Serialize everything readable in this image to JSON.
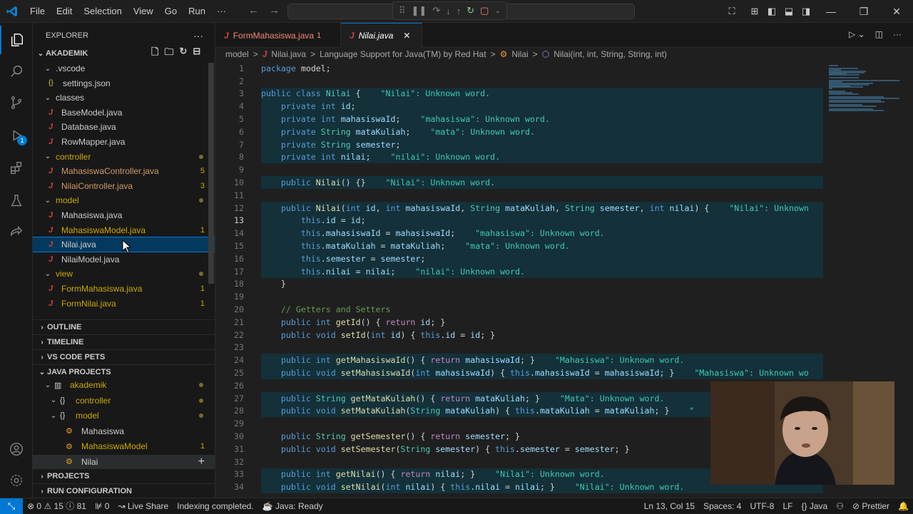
{
  "titlebar": {
    "menu": [
      "File",
      "Edit",
      "Selection",
      "View",
      "Go",
      "Run",
      "···"
    ],
    "back": "←",
    "forward": "→"
  },
  "sidebar": {
    "title": "EXPLORER",
    "more": "···",
    "root": "AKADEMIK",
    "tree": [
      {
        "label": ".vscode",
        "type": "folder",
        "indent": 1
      },
      {
        "label": "settings.json",
        "type": "json",
        "indent": 2
      },
      {
        "label": "classes",
        "type": "folder",
        "indent": 1
      },
      {
        "label": "BaseModel.java",
        "type": "java",
        "indent": 2
      },
      {
        "label": "Database.java",
        "type": "java",
        "indent": 2
      },
      {
        "label": "RowMapper.java",
        "type": "java",
        "indent": 2
      },
      {
        "label": "controller",
        "type": "folder",
        "indent": 1,
        "status": "modified"
      },
      {
        "label": "MahasiswaController.java",
        "type": "java",
        "indent": 2,
        "count": "5",
        "status": "modified"
      },
      {
        "label": "NilaiController.java",
        "type": "java",
        "indent": 2,
        "count": "3",
        "status": "modified"
      },
      {
        "label": "model",
        "type": "folder",
        "indent": 1,
        "status": "modified"
      },
      {
        "label": "Mahasiswa.java",
        "type": "java",
        "indent": 2
      },
      {
        "label": "MahasiswaModel.java",
        "type": "java",
        "indent": 2,
        "count": "1",
        "status": "modified"
      },
      {
        "label": "Nilai.java",
        "type": "java",
        "indent": 2,
        "selected": true
      },
      {
        "label": "NilaiModel.java",
        "type": "java",
        "indent": 2
      },
      {
        "label": "view",
        "type": "folder",
        "indent": 1,
        "status": "modified"
      },
      {
        "label": "FormMahasiswa.java",
        "type": "java",
        "indent": 2,
        "count": "1",
        "status": "modified"
      },
      {
        "label": "FormNilai.java",
        "type": "java",
        "indent": 2,
        "count": "1",
        "status": "modified"
      }
    ],
    "sections": {
      "outline": "OUTLINE",
      "timeline": "TIMELINE",
      "pets": "VS CODE PETS",
      "java_projects": "JAVA PROJECTS",
      "projects": "PROJECTS",
      "run_config": "RUN CONFIGURATION"
    },
    "java_tree": [
      {
        "label": "akademik",
        "indent": 1
      },
      {
        "label": "controller",
        "indent": 2
      },
      {
        "label": "model",
        "indent": 2
      },
      {
        "label": "Mahasiswa",
        "indent": 3
      },
      {
        "label": "MahasiswaModel",
        "indent": 3,
        "count": "1"
      },
      {
        "label": "Nilai",
        "indent": 3
      }
    ],
    "debug_badge": "1"
  },
  "tabs": [
    {
      "label": "FormMahasiswa.java",
      "count": "1",
      "active": false
    },
    {
      "label": "Nilai.java",
      "active": true,
      "close": "✕"
    }
  ],
  "breadcrumb": [
    "model",
    ">",
    "Nilai.java",
    ">",
    "Language Support for Java(TM) by Red Hat",
    ">",
    "Nilai",
    ">",
    "Nilai(int, int, String, String, int)"
  ],
  "editor": {
    "current_line": 13,
    "lines": [
      {
        "n": "1",
        "html": "<span class='kw'>package</span> model;"
      },
      {
        "n": "2",
        "html": ""
      },
      {
        "n": "3",
        "html": "<span class='kw'>public class</span> <span class='ty'>Nilai</span> {    <span class='spell'>\"Nilai\": Unknown word.</span>",
        "hl": true
      },
      {
        "n": "4",
        "html": "    <span class='kw'>private int</span> <span class='vr'>id</span>;",
        "hl": true
      },
      {
        "n": "5",
        "html": "    <span class='kw'>private int</span> <span class='vr'>mahasiswaId</span>;    <span class='spell'>\"mahasiswa\": Unknown word.</span>",
        "hl": true
      },
      {
        "n": "6",
        "html": "    <span class='kw'>private</span> <span class='ty'>String</span> <span class='vr'>mataKuliah</span>;    <span class='spell'>\"mata\": Unknown word.</span>",
        "hl": true
      },
      {
        "n": "7",
        "html": "    <span class='kw'>private</span> <span class='ty'>String</span> <span class='vr'>semester</span>;",
        "hl": true
      },
      {
        "n": "8",
        "html": "    <span class='kw'>private int</span> <span class='vr'>nilai</span>;    <span class='spell'>\"nilai\": Unknown word.</span>",
        "hl": true
      },
      {
        "n": "9",
        "html": ""
      },
      {
        "n": "10",
        "html": "    <span class='kw'>public</span> <span class='fn'>Nilai</span>() {}    <span class='spell'>\"Nilai\": Unknown word.</span>",
        "hl": true
      },
      {
        "n": "11",
        "html": ""
      },
      {
        "n": "12",
        "html": "    <span class='kw'>public</span> <span class='fn'>Nilai</span>(<span class='kw'>int</span> <span class='vr'>id</span>, <span class='kw'>int</span> <span class='vr'>mahasiswaId</span>, <span class='ty'>String</span> <span class='vr'>mataKuliah</span>, <span class='ty'>String</span> <span class='vr'>semester</span>, <span class='kw'>int</span> <span class='vr'>nilai</span>) {    <span class='spell'>\"Nilai\": Unknown</span>",
        "hl": true
      },
      {
        "n": "13",
        "html": "        <span class='kw'>this</span>.<span class='vr'>id</span> = <span class='vr'>id</span>;",
        "hl": true
      },
      {
        "n": "14",
        "html": "        <span class='kw'>this</span>.<span class='vr'>mahasiswaId</span> = <span class='vr'>mahasiswaId</span>;    <span class='spell'>\"mahasiswa\": Unknown word.</span>",
        "hl": true
      },
      {
        "n": "15",
        "html": "        <span class='kw'>this</span>.<span class='vr'>mataKuliah</span> = <span class='vr'>mataKuliah</span>;    <span class='spell'>\"mata\": Unknown word.</span>",
        "hl": true
      },
      {
        "n": "16",
        "html": "        <span class='kw'>this</span>.<span class='vr'>semester</span> = <span class='vr'>semester</span>;",
        "hl": true
      },
      {
        "n": "17",
        "html": "        <span class='kw'>this</span>.<span class='vr'>nilai</span> = <span class='vr'>nilai</span>;    <span class='spell'>\"nilai\": Unknown word.</span>",
        "hl": true
      },
      {
        "n": "18",
        "html": "    }"
      },
      {
        "n": "19",
        "html": ""
      },
      {
        "n": "20",
        "html": "    <span class='cm'>// Getters and Setters</span>"
      },
      {
        "n": "21",
        "html": "    <span class='kw'>public int</span> <span class='fn'>getId</span>() { <span class='ctl'>return</span> <span class='vr'>id</span>; }"
      },
      {
        "n": "22",
        "html": "    <span class='kw'>public void</span> <span class='fn'>setId</span>(<span class='kw'>int</span> <span class='vr'>id</span>) { <span class='kw'>this</span>.<span class='vr'>id</span> = <span class='vr'>id</span>; }"
      },
      {
        "n": "23",
        "html": ""
      },
      {
        "n": "24",
        "html": "    <span class='kw'>public int</span> <span class='fn'>getMahasiswaId</span>() { <span class='ctl'>return</span> <span class='vr'>mahasiswaId</span>; }    <span class='spell'>\"Mahasiswa\": Unknown word.</span>",
        "hl": true
      },
      {
        "n": "25",
        "html": "    <span class='kw'>public void</span> <span class='fn'>setMahasiswaId</span>(<span class='kw'>int</span> <span class='vr'>mahasiswaId</span>) { <span class='kw'>this</span>.<span class='vr'>mahasiswaId</span> = <span class='vr'>mahasiswaId</span>; }    <span class='spell'>\"Mahasiswa\": Unknown wo</span>",
        "hl": true
      },
      {
        "n": "26",
        "html": ""
      },
      {
        "n": "27",
        "html": "    <span class='kw'>public</span> <span class='ty'>String</span> <span class='fn'>getMataKuliah</span>() { <span class='ctl'>return</span> <span class='vr'>mataKuliah</span>; }    <span class='spell'>\"Mata\": Unknown word.</span>",
        "hl": true
      },
      {
        "n": "28",
        "html": "    <span class='kw'>public void</span> <span class='fn'>setMataKuliah</span>(<span class='ty'>String</span> <span class='vr'>mataKuliah</span>) { <span class='kw'>this</span>.<span class='vr'>mataKuliah</span> = <span class='vr'>mataKuliah</span>; }    <span class='spell'>\"</span>",
        "hl": true
      },
      {
        "n": "29",
        "html": ""
      },
      {
        "n": "30",
        "html": "    <span class='kw'>public</span> <span class='ty'>String</span> <span class='fn'>getSemester</span>() { <span class='ctl'>return</span> <span class='vr'>semester</span>; }"
      },
      {
        "n": "31",
        "html": "    <span class='kw'>public void</span> <span class='fn'>setSemester</span>(<span class='ty'>String</span> <span class='vr'>semester</span>) { <span class='kw'>this</span>.<span class='vr'>semester</span> = <span class='vr'>semester</span>; }"
      },
      {
        "n": "32",
        "html": ""
      },
      {
        "n": "33",
        "html": "    <span class='kw'>public int</span> <span class='fn'>getNilai</span>() { <span class='ctl'>return</span> <span class='vr'>nilai</span>; }    <span class='spell'>\"Nilai\": Unknown word.</span>",
        "hl": true
      },
      {
        "n": "34",
        "html": "    <span class='kw'>public void</span> <span class='fn'>setNilai</span>(<span class='kw'>int</span> <span class='vr'>nilai</span>) { <span class='kw'>this</span>.<span class='vr'>nilai</span> = <span class='vr'>nilai</span>; }    <span class='spell'>\"Nilai\": Unknown word.</span>",
        "hl": true
      }
    ]
  },
  "statusbar": {
    "errors": "0",
    "warnings": "15",
    "info": "81",
    "ports": "0",
    "live_share": "Live Share",
    "indexing": "Indexing completed.",
    "java_status": "Java: Ready",
    "position": "Ln 13, Col 15",
    "spaces": "Spaces: 4",
    "encoding": "UTF-8",
    "eol": "LF",
    "language": "Java",
    "prettier": "Prettier"
  }
}
